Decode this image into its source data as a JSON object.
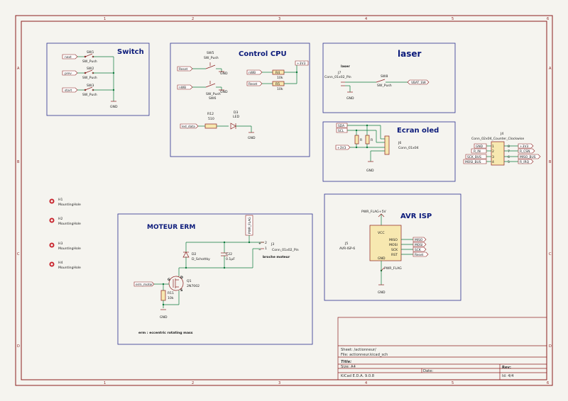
{
  "sections": {
    "switch": "Switch",
    "control_cpu": "Control CPU",
    "laser": "laser",
    "ecran_oled": "Ecran oled",
    "moteur_erm": "MOTEUR ERM",
    "avr_isp": "AVR ISP"
  },
  "switch_section": {
    "labels": [
      "next",
      "prev",
      "start"
    ],
    "switches": [
      {
        "ref": "SW1",
        "value": "SW_Push"
      },
      {
        "ref": "SW2",
        "value": "SW_Push"
      },
      {
        "ref": "SW3",
        "value": "SW_Push"
      }
    ],
    "gnd": "GND"
  },
  "control_cpu_section": {
    "reset_label": "Reset",
    "nwb_label": "nWB",
    "sw5": {
      "ref": "SW5",
      "value": "SW_Push"
    },
    "sw6": {
      "ref": "SW6",
      "value": "SW_Push"
    },
    "gnd": "GND",
    "power": "+3V3",
    "nwb_right": "nWB",
    "reset_right": "Reset",
    "r1": {
      "ref": "R4",
      "value": "10k"
    },
    "r2": {
      "ref": "R5",
      "value": "10k"
    },
    "r12": {
      "ref": "R12",
      "value": "510"
    },
    "d3": {
      "ref": "D3",
      "value": "LED"
    },
    "led_label": "led_data",
    "gnd2": "GND"
  },
  "laser_section": {
    "heading": "laser",
    "j7_ref": "J7",
    "j7_value": "Conn_01x02_Pin",
    "sw8": {
      "ref": "SW8",
      "value": "SW_Push"
    },
    "vbat_label": "VBAT_SW",
    "gnd": "GND"
  },
  "oled_section": {
    "sda": "SDA",
    "scl": "SCL",
    "power": "+3V3",
    "j6_ref": "J6",
    "j6_value": "Conn_01x04",
    "gnd": "GND",
    "r_a": "R",
    "r_b": "R"
  },
  "j4": {
    "ref": "J4",
    "value": "Conn_02x04_Counter_Clockwise",
    "left_labels": [
      "GND",
      "R_IN",
      "SCK_BUS",
      "MOSI_BUS"
    ],
    "right_labels": [
      "+3V3",
      "R_CSN",
      "MISO_BUS",
      "R_IRQ"
    ],
    "left_pins": [
      "1",
      "2",
      "3",
      "4"
    ],
    "right_pins": [
      "8",
      "7",
      "6",
      "5"
    ]
  },
  "mounting_holes": [
    {
      "ref": "H1",
      "value": "MountingHole"
    },
    {
      "ref": "H2",
      "value": "MountingHole"
    },
    {
      "ref": "H3",
      "value": "MountingHole"
    },
    {
      "ref": "H4",
      "value": "MountingHole"
    }
  ],
  "moteur_section": {
    "power_tag": "PWR_FLAG",
    "d2": {
      "ref": "D2",
      "value": "D_Schottky"
    },
    "c22": {
      "ref": "C22",
      "value": "0.1µF"
    },
    "j3": {
      "ref": "J3",
      "value": "Conn_01x02_Pin"
    },
    "j3_note": "broche moteur",
    "q1": {
      "ref": "Q1",
      "value": "2N7002"
    },
    "r11": {
      "ref": "R11",
      "value": "10k"
    },
    "input_label": "erm_motor",
    "gnd": "GND",
    "note": "erm : eccentric rotating mass",
    "pin_g": "G",
    "pin_d": "D",
    "pin_s": "S"
  },
  "avr_section": {
    "pwr_top": "PWR_FLAG+5V",
    "j5_ref": "J5",
    "j5_value": "AVR-ISP-6",
    "signals": [
      "MISO",
      "MOSI",
      "SCK",
      "RST"
    ],
    "labels": [
      "MISO",
      "MOSI",
      "SCK",
      "Reset"
    ],
    "vcc": "VCC",
    "gnd_pin": "GND",
    "pwr_bottom": "PWR_FLAG",
    "gnd": "GND"
  },
  "title_block": {
    "sheet": "Sheet: /actionneur/",
    "file": "File: actionneur.kicad_sch",
    "title_label": "Title:",
    "size": "Size: A4",
    "date": "Date:",
    "rev": "Rev:",
    "tool": "KiCad E.D.A. 9.0.8",
    "id": "Id: 4/4"
  },
  "ruler": {
    "top": [
      "1",
      "2",
      "3",
      "4",
      "5",
      "6"
    ],
    "side": [
      "A",
      "B",
      "C",
      "D"
    ]
  },
  "colors": {
    "frame": "#8b1e1e",
    "box": "#2a2f8f",
    "wire": "#0b7a3b",
    "title": "#0b1a7a"
  }
}
